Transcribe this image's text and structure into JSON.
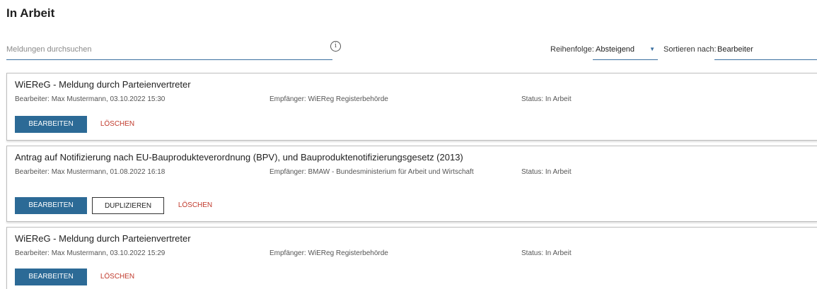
{
  "page": {
    "title": "In Arbeit"
  },
  "search": {
    "placeholder": "Meldungen durchsuchen",
    "info_icon": "info-icon"
  },
  "order": {
    "label": "Reihenfolge:",
    "value": "Absteigend"
  },
  "sort": {
    "label": "Sortieren nach:",
    "value": "Bearbeiter"
  },
  "colors": {
    "primary": "#2c6a96",
    "danger": "#c0392b",
    "border": "#bdbdbd"
  },
  "cards": [
    {
      "title": "WiEReG - Meldung durch Parteienvertreter",
      "editor": "Bearbeiter: Max Mustermann, 03.10.2022 15:30",
      "recipient": "Empfänger: WiEReg Registerbehörde",
      "status": "Status: In Arbeit",
      "edit_label": "BEARBEITEN",
      "delete_label": "LÖSCHEN"
    },
    {
      "title": "Antrag auf Notifizierung nach EU-Bauprodukteverordnung (BPV), und Bauproduktenotifizierungsgesetz (2013)",
      "editor": "Bearbeiter: Max Mustermann, 01.08.2022 16:18",
      "recipient": "Empfänger: BMAW - Bundesministerium für Arbeit und Wirtschaft",
      "status": "Status: In Arbeit",
      "edit_label": "BEARBEITEN",
      "duplicate_label": "DUPLIZIEREN",
      "delete_label": "LÖSCHEN"
    },
    {
      "title": "WiEReG - Meldung durch Parteienvertreter",
      "editor": "Bearbeiter: Max Mustermann, 03.10.2022 15:29",
      "recipient": "Empfänger: WiEReg Registerbehörde",
      "status": "Status: In Arbeit",
      "edit_label": "BEARBEITEN",
      "delete_label": "LÖSCHEN"
    }
  ]
}
